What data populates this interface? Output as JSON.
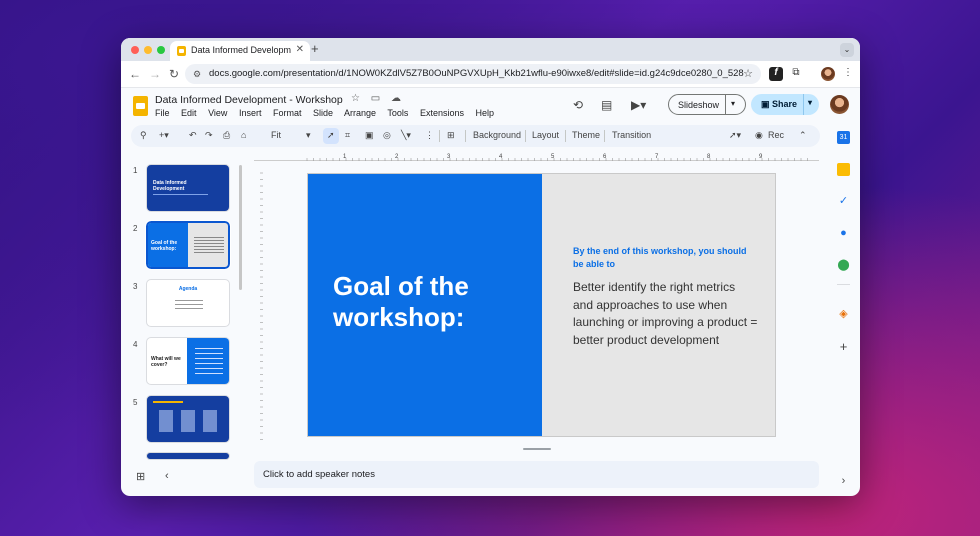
{
  "browser": {
    "tab_title": "Data Informed Development",
    "tab_close": "✕",
    "new_tab": "+",
    "url": "docs.google.com/presentation/d/1NOW0KZdlV5Z7B0OuNPGVXUpH_Kkb21wflu-e90iwxe8/edit#slide=id.g24c9dce0280_0_528",
    "traffic_colors": [
      "#ff5f57",
      "#febc2e",
      "#28c840"
    ]
  },
  "doc": {
    "title": "Data Informed Development - Workshop",
    "menu": [
      "File",
      "Edit",
      "View",
      "Insert",
      "Format",
      "Slide",
      "Arrange",
      "Tools",
      "Extensions",
      "Help"
    ],
    "slideshow_label": "Slideshow",
    "share_label": "Share"
  },
  "toolbar": {
    "zoom": "Fit",
    "background": "Background",
    "layout": "Layout",
    "theme": "Theme",
    "transition": "Transition",
    "rec": "Rec"
  },
  "ruler": [
    "1",
    "2",
    "3",
    "4",
    "5",
    "6",
    "7",
    "8",
    "9"
  ],
  "filmstrip": [
    {
      "num": "1",
      "title": "Data Informed Development"
    },
    {
      "num": "2",
      "title": "Goal of the workshop:"
    },
    {
      "num": "3",
      "title": "Agenda"
    },
    {
      "num": "4",
      "title": "What will we cover?"
    },
    {
      "num": "5",
      "title": ""
    }
  ],
  "slide": {
    "heading": "Goal of the\nworkshop:",
    "subheading": "By the end of this workshop, you should be able to",
    "body": "Better identify the right metrics and approaches to use when launching or improving a product = better product development"
  },
  "notes": {
    "placeholder": "Click to add speaker notes"
  },
  "colors": {
    "accent_blue": "#0b6fe5",
    "share_bg": "#c2e7ff",
    "thumb_dark": "#143ea0"
  }
}
